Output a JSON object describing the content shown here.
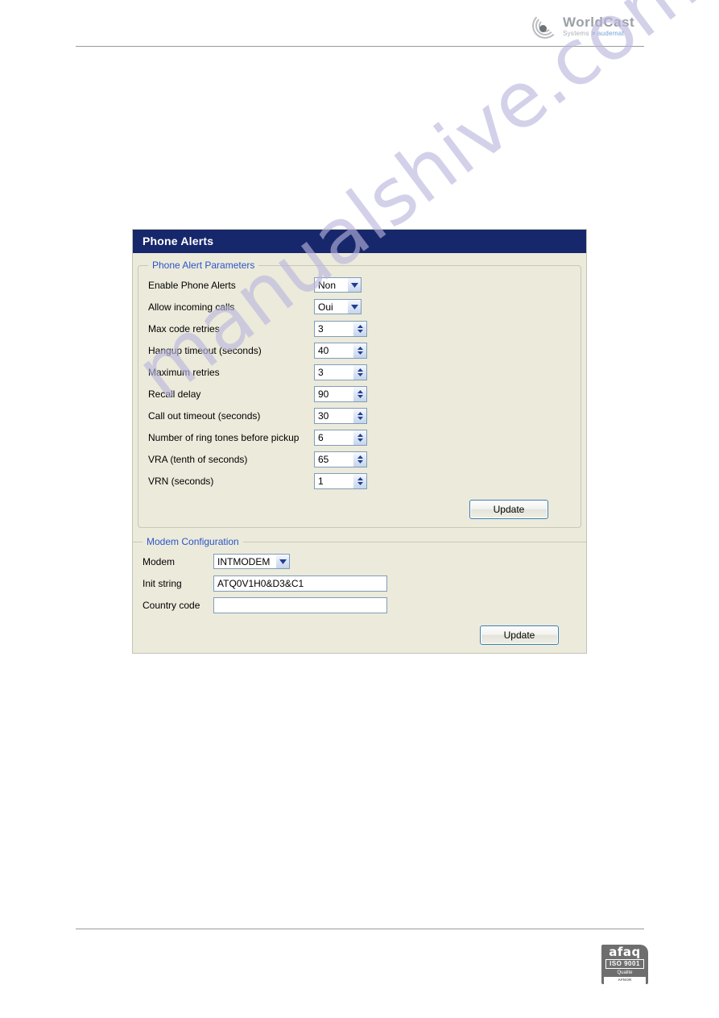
{
  "brand": {
    "name": "WorldCast",
    "subtitle_prefix": "Systems",
    "subtitle_arrow": ">",
    "subtitle_accent": "audemat",
    "mark_icon": "signal-waves-icon"
  },
  "watermark": {
    "text": "manualshive.com"
  },
  "certification": {
    "afaq": "afaq",
    "iso": "ISO 9001",
    "quality": "Qualite",
    "afnor": "AFNOR CERTIFICATION"
  },
  "panel": {
    "title": "Phone Alerts",
    "sections": [
      {
        "title": "Phone Alert Parameters",
        "rows": [
          {
            "label": "Enable Phone Alerts",
            "control": "select",
            "value": "Non"
          },
          {
            "label": "Allow incoming calls",
            "control": "select",
            "value": "Oui"
          },
          {
            "label": "Max code retries",
            "control": "spinner",
            "value": "3"
          },
          {
            "label": "Hangup timeout (seconds)",
            "control": "spinner",
            "value": "40"
          },
          {
            "label": "Maximum retries",
            "control": "spinner",
            "value": "3"
          },
          {
            "label": "Recall delay",
            "control": "spinner",
            "value": "90"
          },
          {
            "label": "Call out timeout (seconds)",
            "control": "spinner",
            "value": "30"
          },
          {
            "label": "Number of ring tones before pickup",
            "control": "spinner",
            "value": "6"
          },
          {
            "label": "VRA (tenth of seconds)",
            "control": "spinner",
            "value": "65"
          },
          {
            "label": "VRN (seconds)",
            "control": "spinner",
            "value": "1"
          }
        ],
        "update_label": "Update"
      },
      {
        "title": "Modem Configuration",
        "rows": [
          {
            "label": "Modem",
            "control": "select",
            "value": "INTMODEM"
          },
          {
            "label": "Init string",
            "control": "text",
            "value": "ATQ0V1H0&D3&C1"
          },
          {
            "label": "Country code",
            "control": "text",
            "value": ""
          }
        ],
        "update_label": "Update"
      }
    ]
  }
}
